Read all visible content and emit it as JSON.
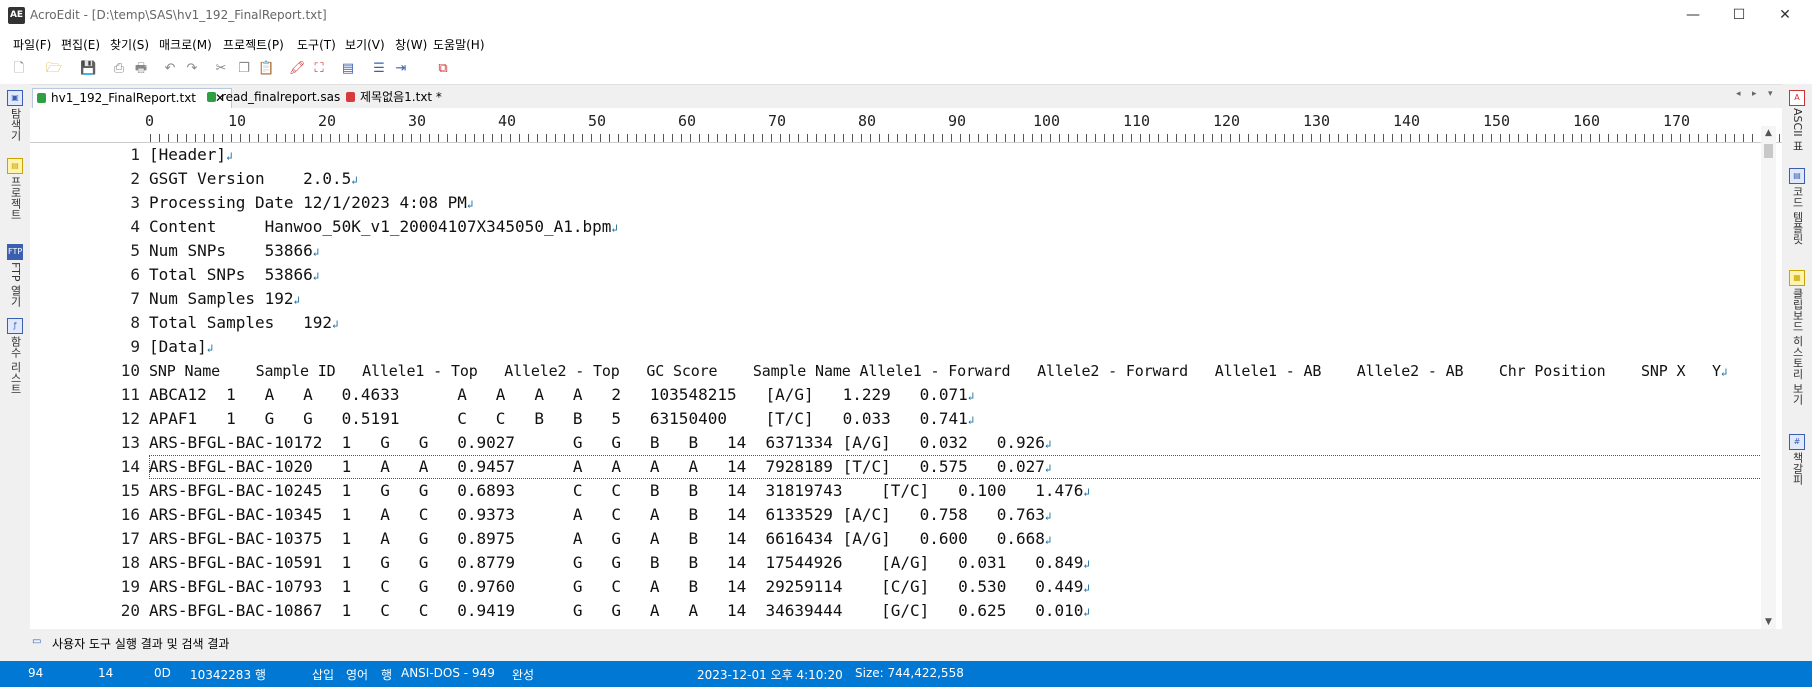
{
  "window": {
    "app_icon": "AE",
    "title": "AcroEdit - [D:\\temp\\SAS\\hv1_192_FinalReport.txt]",
    "minimize": "—",
    "maximize": "☐",
    "close": "✕"
  },
  "menu": [
    "파일(F)",
    "편집(E)",
    "찾기(S)",
    "매크로(M)",
    "프로젝트(P)",
    "도구(T)",
    "보기(V)",
    "창(W)",
    "도움말(H)"
  ],
  "tabs": [
    {
      "label": "hv1_192_FinalReport.txt",
      "close": "✕",
      "color": "#2ea043"
    },
    {
      "label": "read_finalreport.sas",
      "color": "#2ea043"
    },
    {
      "label": "제목없음1.txt *",
      "color": "#d73a3a"
    }
  ],
  "tab_nav": {
    "prev": "◂",
    "next": "▸",
    "list": "▾"
  },
  "left_sidebar": [
    "탐색기",
    "프로젝트",
    "FTP 열기",
    "함수 리스트"
  ],
  "left_sidebar_icons": [
    "explorer-icon",
    "project-icon",
    "ftp-icon",
    "function-list-icon"
  ],
  "right_sidebar": [
    "ASCII 표",
    "코드 템플릿",
    "클립보드 히스토리 보기",
    "책갈피"
  ],
  "right_sidebar_icons": [
    "ascii-table-icon",
    "code-template-icon",
    "clipboard-history-icon",
    "bookmark-icon"
  ],
  "ruler": [
    "0",
    "10",
    "20",
    "30",
    "40",
    "50",
    "60",
    "70",
    "80",
    "90",
    "100",
    "110",
    "120",
    "130",
    "140",
    "150",
    "160",
    "170"
  ],
  "line_numbers": [
    "1",
    "2",
    "3",
    "4",
    "5",
    "6",
    "7",
    "8",
    "9",
    "10",
    "11",
    "12",
    "13",
    "14",
    "15",
    "16",
    "17",
    "18",
    "19",
    "20"
  ],
  "lines": [
    "[Header]",
    "GSGT Version    2.0.5",
    "Processing Date 12/1/2023 4:08 PM",
    "Content     Hanwoo_50K_v1_20004107X345050_A1.bpm",
    "Num SNPs    53866",
    "Total SNPs  53866",
    "Num Samples 192",
    "Total Samples   192",
    "[Data]",
    "SNP Name    Sample ID   Allele1 - Top   Allele2 - Top   GC Score    Sample Name Allele1 - Forward   Allele2 - Forward   Allele1 - AB    Allele2 - AB    Chr Position    SNP X   Y",
    "ABCA12  1   A   A   0.4633      A   A   A   A   2   103548215   [A/G]   1.229   0.071",
    "APAF1   1   G   G   0.5191      C   C   B   B   5   63150400    [T/C]   0.033   0.741",
    "ARS-BFGL-BAC-10172  1   G   G   0.9027      G   G   B   B   14  6371334 [A/G]   0.032   0.926",
    "ARS-BFGL-BAC-1020   1   A   A   0.9457      A   A   A   A   14  7928189 [T/C]   0.575   0.027",
    "ARS-BFGL-BAC-10245  1   G   G   0.6893      C   C   B   B   14  31819743    [T/C]   0.100   1.476",
    "ARS-BFGL-BAC-10345  1   A   C   0.9373      A   C   A   B   14  6133529 [A/C]   0.758   0.763",
    "ARS-BFGL-BAC-10375  1   A   G   0.8975      A   G   A   B   14  6616434 [A/G]   0.600   0.668",
    "ARS-BFGL-BAC-10591  1   G   G   0.8779      G   G   B   B   14  17544926    [A/G]   0.031   0.849",
    "ARS-BFGL-BAC-10793  1   C   G   0.9760      G   C   A   B   14  29259114    [C/G]   0.530   0.449",
    "ARS-BFGL-BAC-10867  1   C   C   0.9419      G   G   A   A   14  34639444    [G/C]   0.625   0.010"
  ],
  "eol_mark": "↲",
  "scrollbar": {
    "up": "▲",
    "down": "▼"
  },
  "bottom_panel": {
    "icon": "output-icon",
    "label": "사용자 도구 실행 결과 및 검색 결과"
  },
  "status": {
    "col": "94",
    "line": "14",
    "char": "0D",
    "total_lines": "10342283 행",
    "insert": "삽입",
    "lang": "영어",
    "line_mode": "행",
    "encoding": "ANSI-DOS - 949",
    "complete": "완성",
    "datetime": "2023-12-01 오후 4:10:20",
    "size": "Size: 744,422,558"
  }
}
